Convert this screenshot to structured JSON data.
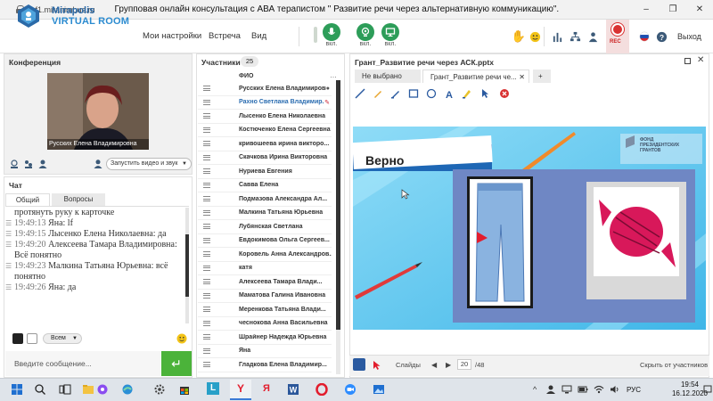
{
  "browser": {
    "url": "mf1.miranimbus.ru",
    "page_title": "Групповая онлайн консультация с АВА терапистом \" Развитие речи через альтернативную коммуникацию\".",
    "controls": [
      "–",
      "❐",
      "✕"
    ]
  },
  "app": {
    "logo_line1": "Mirapolis",
    "logo_line2": "VIRTUAL ROOM",
    "menu": [
      "Мои настройки",
      "Встреча",
      "Вид"
    ],
    "mic_label": "вкл.",
    "cam_label": "вкл.",
    "screen_label": "вкл.",
    "rec_label": "REC",
    "exit_label": "Выход",
    "colors": {
      "green": "#2d9d59",
      "rec": "#d93232",
      "accent_blue": "#2b6aa8"
    }
  },
  "conference": {
    "title": "Конференция",
    "video_name": "Русских Елена Владимировна",
    "start_video": "Запустить видео и звук"
  },
  "chat": {
    "title": "Чат",
    "tabs": [
      "Общий",
      "Вопросы"
    ],
    "messages": [
      {
        "time": "",
        "text": "протянуть руку к карточке"
      },
      {
        "time": "19:49:13",
        "text": " Яна: lf"
      },
      {
        "time": "19:49:15",
        "text": " Лысенко Елена  Николаевна: да"
      },
      {
        "time": "19:49:20",
        "text": " Алексеева   Тамара Владимировна: Всё понятно"
      },
      {
        "time": "19:49:23",
        "text": " Малкина Татьяна  Юрьевна: всё понятно"
      },
      {
        "time": "19:49:26",
        "text": " Яна: да"
      }
    ],
    "recipient": "Всем",
    "input_placeholder": "Введите сообщение..."
  },
  "participants": {
    "title": "Участники",
    "count": "25",
    "column": "ФИО",
    "list": [
      "Русских Елена Владимировна",
      "Рахно Светлана  Владимир...",
      "Лысенко Елена  Николаевна",
      "Костюченко Елена Сергеевна",
      "кривошеева  ирина викторо...",
      "Скачкова  Ирина Викторовна",
      "Нуриева Евгения",
      "Савва  Елена",
      "Подмазова  Александра  Ал...",
      "Малкина Татьяна  Юрьевна",
      "Лубянская  Светлана",
      "Евдокимова Ольга  Сергеев...",
      "Коровель Анна  Александров...",
      "катя",
      "Алексеева   Тамара  Влади...",
      "Маматова  Галина Ивановна",
      "Меренкова  Татьяна  Влади...",
      "чеснокова  Анна  Васильевна",
      "Шрайнер  Надежда Юрьевна",
      "Яна",
      "Гладкова  Елена Владимир..."
    ],
    "highlight_index": 1
  },
  "presentation": {
    "title": "Грант_Развитие речи через АСК.pptx",
    "tabs": [
      "Не выбрано",
      "Грант_Развитие речи че...",
      "+"
    ],
    "slide_word": "Верно",
    "fund_line1": "ФОНД",
    "fund_line2": "ПРЕЗИДЕНТСКИХ",
    "fund_line3": "ГРАНТОВ",
    "slides_label": "Слайды",
    "current_slide": "20",
    "total_slides": "/48",
    "hide_label": "Скрыть от участников"
  },
  "taskbar": {
    "lang": "РУС",
    "time": "19:54",
    "date": "16.12.2020"
  }
}
